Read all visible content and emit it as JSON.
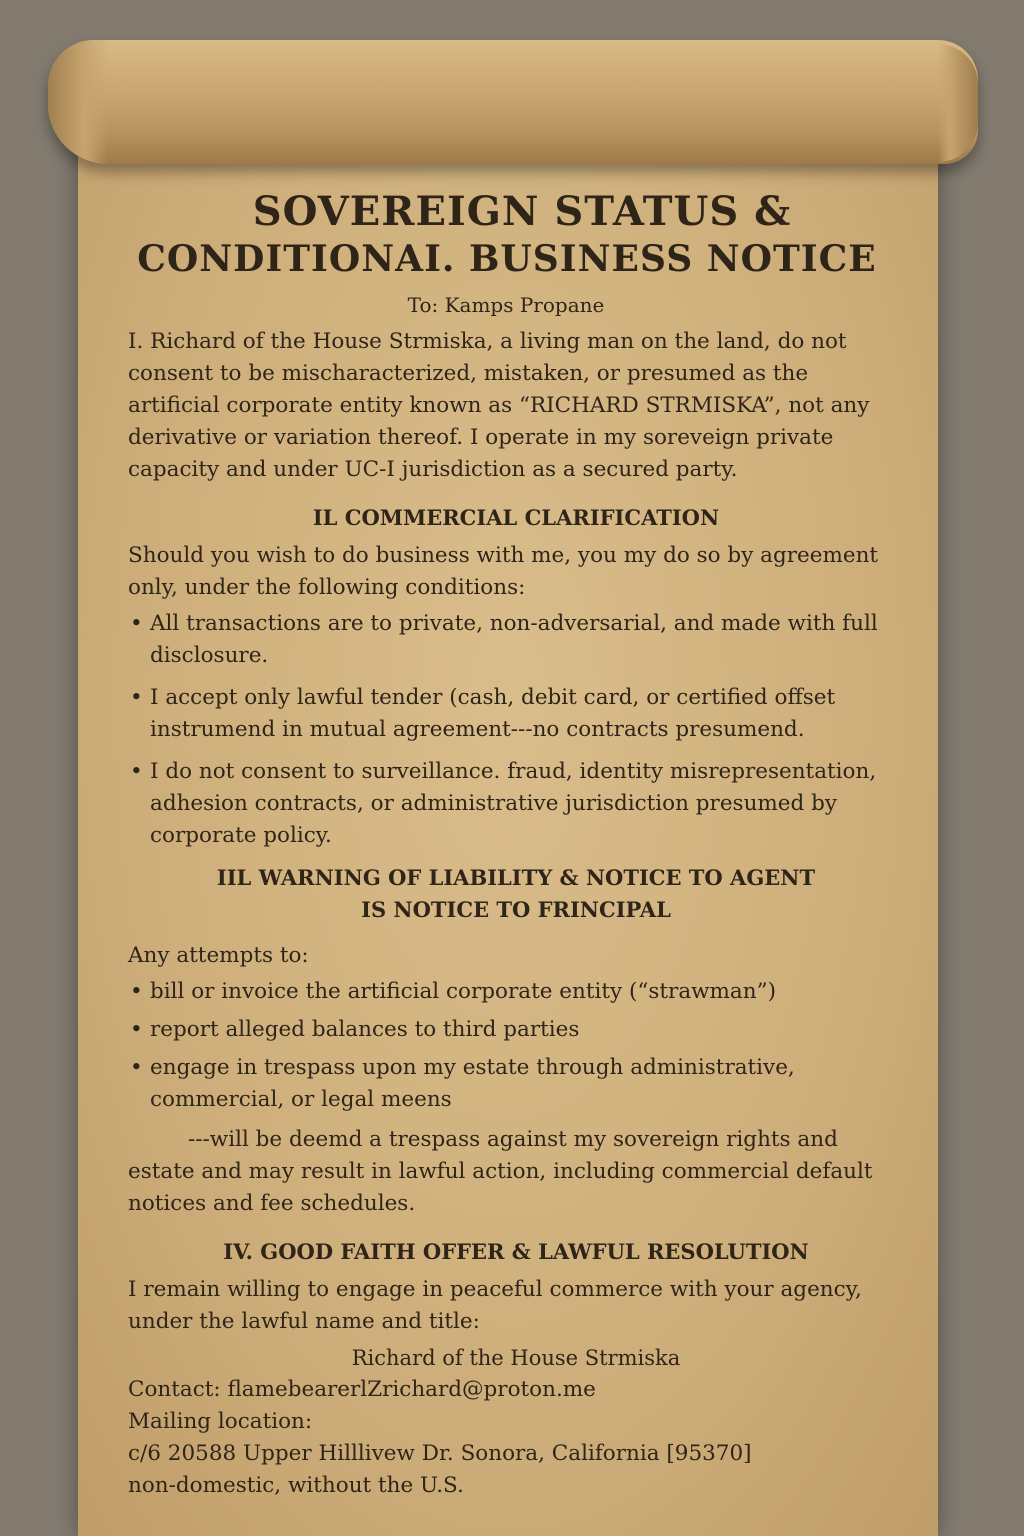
{
  "document": {
    "title_line_1": "SOVEREIGN STATUS &",
    "title_line_2": "CONDITIONAI. BUSINESS NOTICE",
    "to_line": "To: Kamps Propane",
    "intro_paragraph": "I. Richard of the House Strmiska, a living man on the land, do not consent to be mischaracterized, mistaken, or presumed as the artificial corporate entity known as “RICHARD STRMISKA”, not any derivative or variation thereof. I operate in my soreveign private capacity and under UC-I jurisdiction as a secured party.",
    "section_2": {
      "heading": "IL COMMERCIAL CLARIFICATION",
      "intro": "Should you wish to do business with me, you my do so by agreement only, under the following conditions:",
      "bullets": [
        "All transactions are to private, non-adversarial, and made with full disclosure.",
        "I accept only lawful tender (cash, debit card, or certified offset instrumend in mutual agreement---no contracts presumend.",
        "I do not consent to surveillance. fraud, identity misrepresentation, adhesion contracts, or administrative jurisdiction presumed by corporate policy."
      ]
    },
    "section_3": {
      "heading_line_1": "IIL WARNING OF LIABILITY & NOTICE TO AGENT",
      "heading_line_2": "IS NOTICE TO FRINCIPAL",
      "intro": "Any attempts to:",
      "bullets": [
        "bill or invoice the artificial corporate entity (“strawman”)",
        "report alleged balances to third parties",
        "engage in trespass upon my estate through administrative, commercial, or legal meens"
      ],
      "conclusion": "---will be deemd a trespass against my sovereign rights and estate and may result in lawful action, including commercial default notices and fee schedules."
    },
    "section_4": {
      "heading": "IV. GOOD FAITH OFFER & LAWFUL RESOLUTION",
      "intro": "I remain willing to engage in peaceful commerce with your agency, under the lawful name and title:",
      "name": "Richard of the House Strmiska",
      "contact": "Contact: flamebearerlZrichard@proton.me",
      "mailing_label": "Mailing location:",
      "address": "c/6 20588 Upper Hilllivew Dr. Sonora, California [95370]",
      "status": "non-domestic, without the U.S."
    },
    "bullet_symbol": "•"
  }
}
